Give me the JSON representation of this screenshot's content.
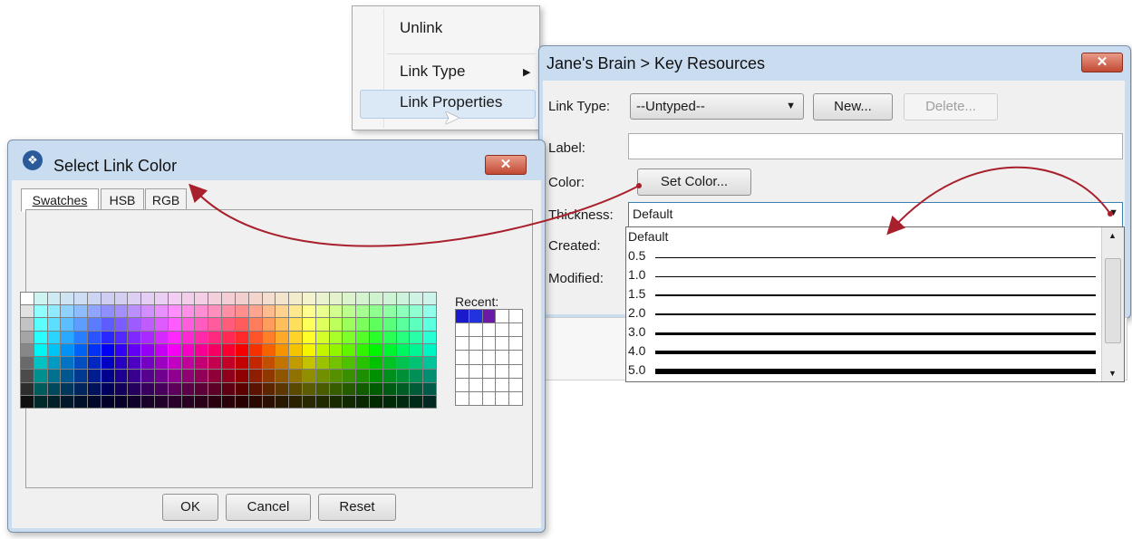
{
  "context_menu": {
    "items": [
      {
        "label": "Unlink"
      },
      {
        "label": "Link Type"
      },
      {
        "label": "Link Properties"
      }
    ]
  },
  "link_properties": {
    "title": "Jane's Brain > Key Resources",
    "link_type_label": "Link Type:",
    "link_type_value": "--Untyped--",
    "new_button": "New...",
    "delete_button": "Delete...",
    "label_label": "Label:",
    "label_value": "",
    "color_label": "Color:",
    "set_color_button": "Set Color...",
    "thickness_label": "Thickness:",
    "thickness_value": "Default",
    "created_label": "Created:",
    "modified_label": "Modified:",
    "thickness_options": [
      {
        "label": "Default",
        "weight": 0
      },
      {
        "label": "0.5",
        "weight": 0.5
      },
      {
        "label": "1.0",
        "weight": 1
      },
      {
        "label": "1.5",
        "weight": 1.5
      },
      {
        "label": "2.0",
        "weight": 2
      },
      {
        "label": "3.0",
        "weight": 3
      },
      {
        "label": "4.0",
        "weight": 4
      },
      {
        "label": "5.0",
        "weight": 5
      }
    ]
  },
  "select_link_color": {
    "title": "Select Link Color",
    "tabs": [
      {
        "label": "Swatches"
      },
      {
        "label": "HSB"
      },
      {
        "label": "RGB"
      }
    ],
    "recent_label": "Recent:",
    "recent_colors": [
      "#1a1acc",
      "#2233dd",
      "#6a1aa6"
    ],
    "ok_button": "OK",
    "cancel_button": "Cancel",
    "reset_button": "Reset"
  },
  "colors": {
    "title_bar": "#c9dcf0",
    "close_button": "#c24a33",
    "arrow": "#a8202c",
    "menu_highlight": "#dbe8f5"
  }
}
